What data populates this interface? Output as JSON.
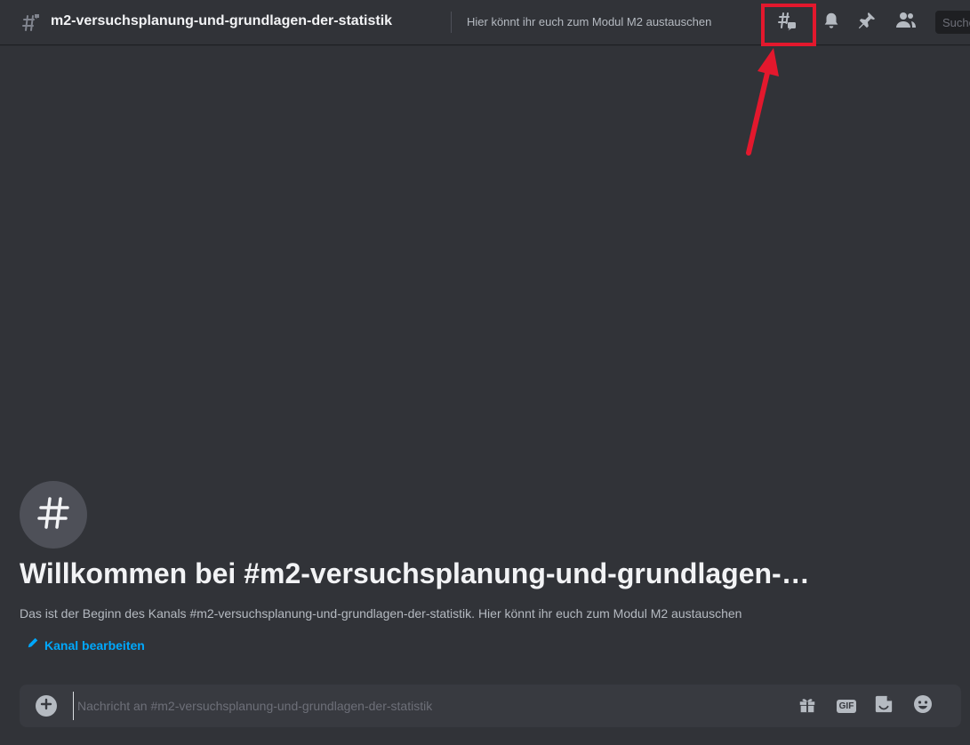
{
  "header": {
    "channel_name": "m2-versuchsplanung-und-grundlagen-der-statistik",
    "topic": "Hier könnt ihr euch zum Modul M2 austauschen",
    "search_placeholder": "Suchen"
  },
  "welcome": {
    "title": "Willkommen bei #m2-versuchsplanung-und-grundlagen-…",
    "description": "Das ist der Beginn des Kanals #m2-versuchsplanung-und-grundlagen-der-statistik. Hier könnt ihr euch zum Modul M2 austauschen",
    "edit_link": "Kanal bearbeiten"
  },
  "composer": {
    "placeholder": "Nachricht an #m2-versuchsplanung-und-grundlagen-der-statistik",
    "gif_label": "GIF"
  },
  "colors": {
    "background": "#313338",
    "link": "#00a8fc",
    "highlight": "#e3182d"
  },
  "icons": {
    "header_channel": "threaded-channel-icon",
    "threads": "threads-icon",
    "bell": "bell-icon",
    "pin": "pin-icon",
    "members": "members-icon",
    "welcome": "hashtag-icon",
    "edit": "pencil-icon",
    "add": "plus-circle-icon",
    "gift": "gift-icon",
    "sticker": "sticker-icon",
    "emoji": "emoji-icon"
  }
}
